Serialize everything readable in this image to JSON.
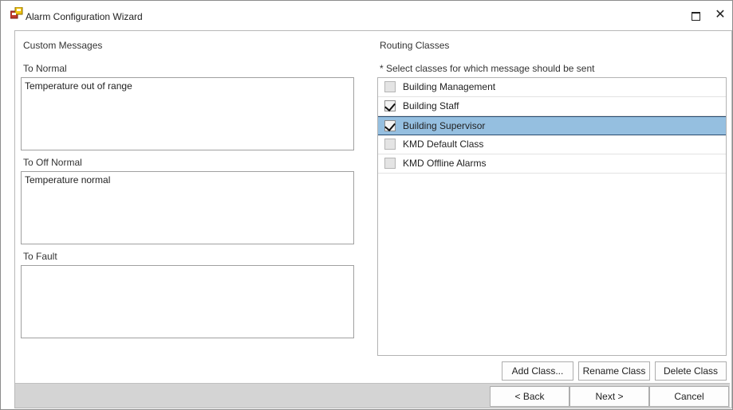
{
  "window": {
    "title": "Alarm Configuration Wizard",
    "maximize_glyph": "□",
    "close_glyph": "✕"
  },
  "custom_messages": {
    "heading": "Custom Messages",
    "to_normal_label": "To Normal",
    "to_normal_value": "Temperature out of range",
    "to_off_normal_label": "To Off Normal",
    "to_off_normal_value": "Temperature normal",
    "to_fault_label": "To Fault",
    "to_fault_value": ""
  },
  "routing": {
    "heading": "Routing Classes",
    "hint": "* Select classes for which message should be sent",
    "classes": [
      {
        "label": "Building Management",
        "checked": false,
        "selected": false
      },
      {
        "label": "Building Staff",
        "checked": true,
        "selected": false
      },
      {
        "label": "Building Supervisor",
        "checked": true,
        "selected": true
      },
      {
        "label": "KMD Default Class",
        "checked": false,
        "selected": false
      },
      {
        "label": "KMD Offline Alarms",
        "checked": false,
        "selected": false
      }
    ],
    "add_label": "Add Class...",
    "rename_label": "Rename Class",
    "delete_label": "Delete Class"
  },
  "footer": {
    "back_label": "<  Back",
    "next_label": "Next >",
    "cancel_label": "Cancel"
  },
  "colors": {
    "selection": "#95bfe0",
    "footer_bg": "#d4d4d4"
  }
}
